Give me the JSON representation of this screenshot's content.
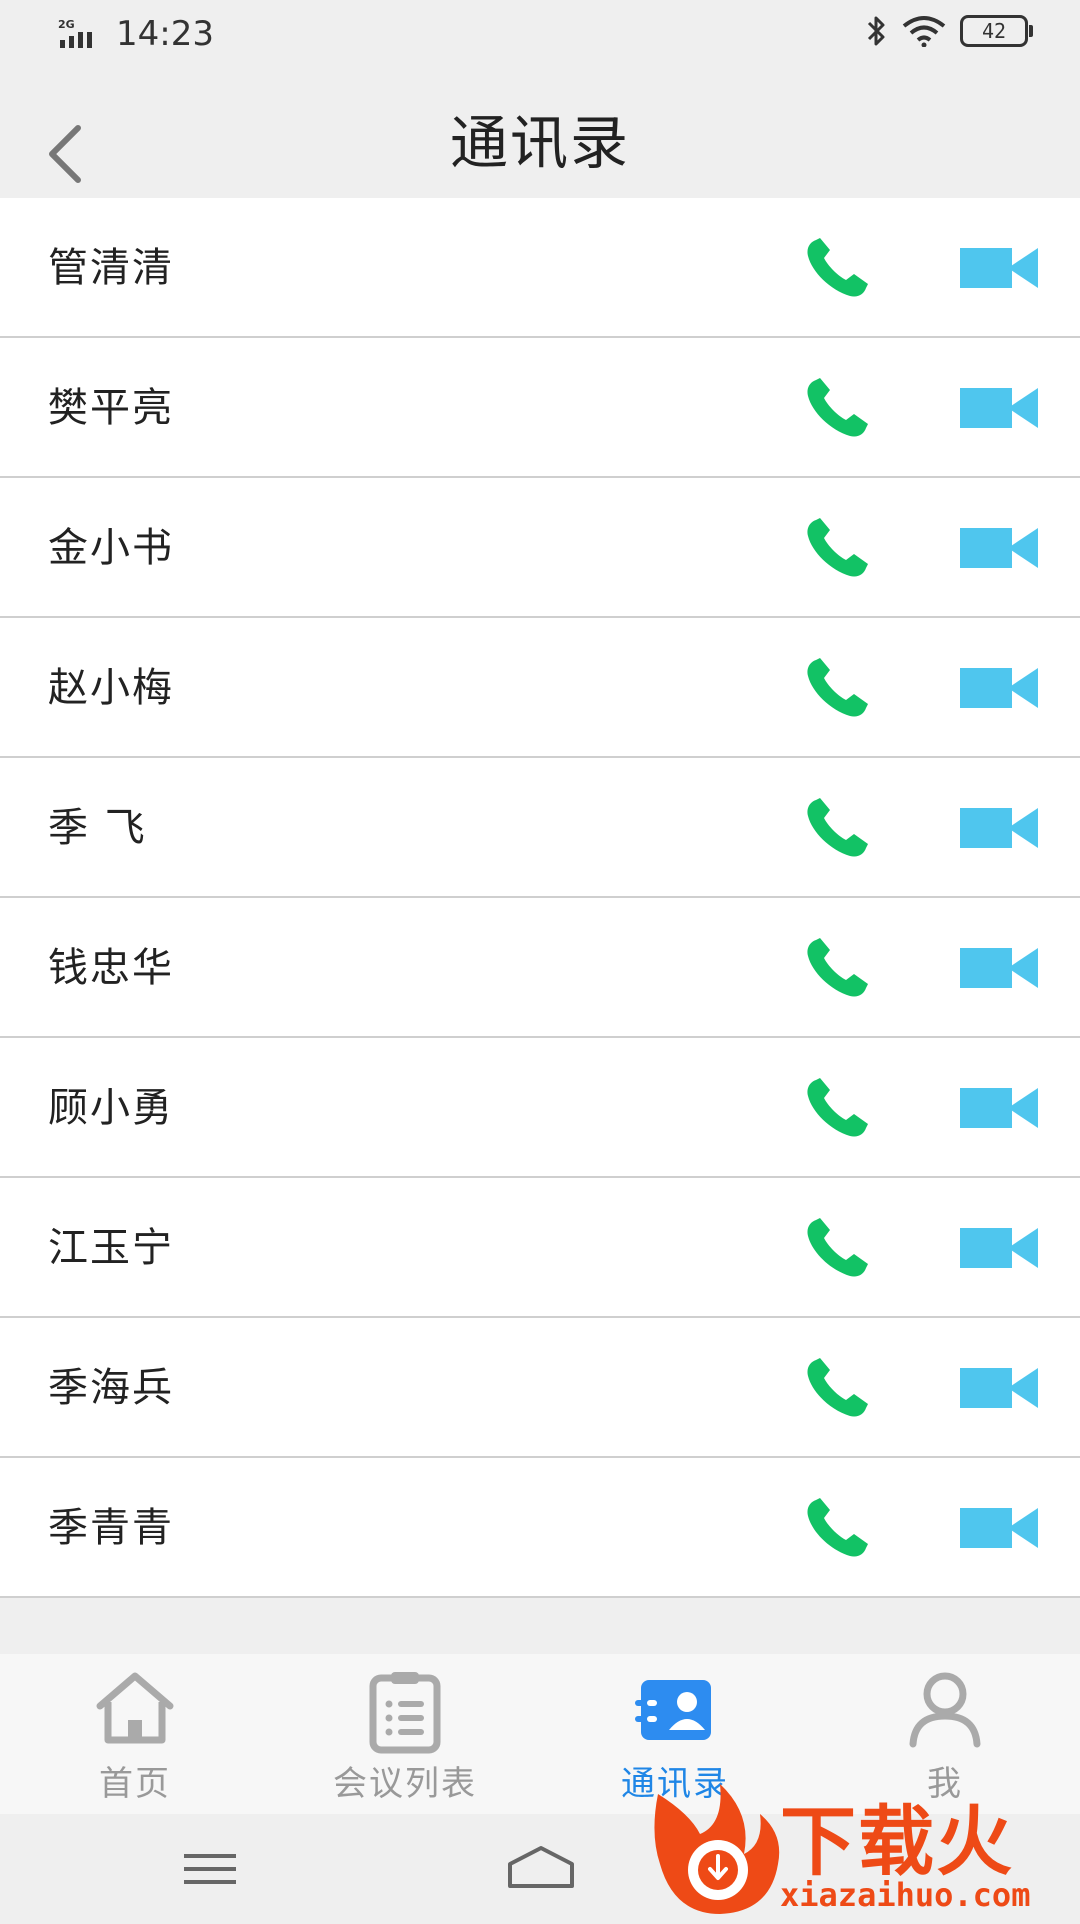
{
  "status_bar": {
    "network": "2G",
    "time": "14:23",
    "battery": "42"
  },
  "header": {
    "title": "通讯录"
  },
  "contacts": [
    {
      "name": "管清清"
    },
    {
      "name": "樊平亮"
    },
    {
      "name": "金小书"
    },
    {
      "name": "赵小梅"
    },
    {
      "name": "季 飞"
    },
    {
      "name": "钱忠华"
    },
    {
      "name": "顾小勇"
    },
    {
      "name": "江玉宁"
    },
    {
      "name": "季海兵"
    },
    {
      "name": "季青青"
    }
  ],
  "icons": {
    "call": "phone-icon",
    "video": "video-camera-icon"
  },
  "colors": {
    "call_green": "#12c265",
    "video_blue": "#4fc6ee",
    "active_tab": "#1f86e6",
    "inactive_tab": "#999999",
    "watermark": "#ee4a16"
  },
  "tab_bar": {
    "tabs": [
      {
        "label": "首页",
        "icon": "home-icon"
      },
      {
        "label": "会议列表",
        "icon": "clipboard-list-icon"
      },
      {
        "label": "通讯录",
        "icon": "contacts-icon",
        "active": true
      },
      {
        "label": "我",
        "icon": "person-icon"
      }
    ]
  },
  "watermark": {
    "text": "下载火",
    "url": "xiazaihuo.com"
  }
}
